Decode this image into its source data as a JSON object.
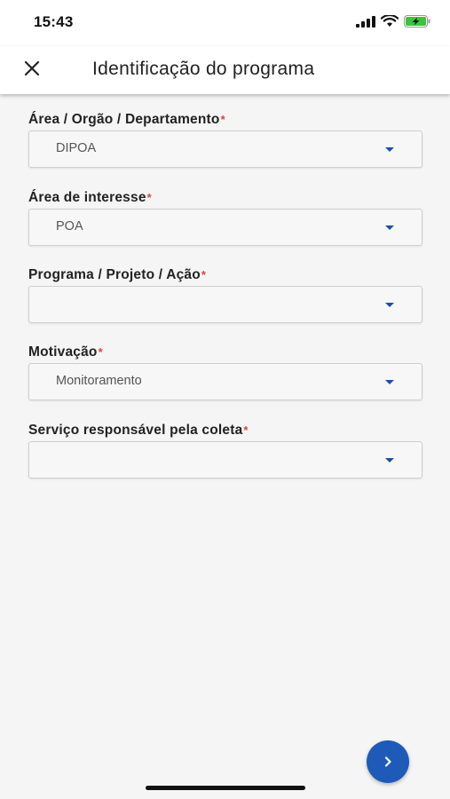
{
  "status_bar": {
    "time": "15:43",
    "icons": [
      "signal-icon",
      "wifi-icon",
      "battery-charging-icon"
    ],
    "battery_color": "#3ec33e"
  },
  "header": {
    "title": "Identificação do programa",
    "close_icon": "close-icon"
  },
  "form": {
    "required_marker": "*",
    "fields": [
      {
        "label": "Área / Orgão / Departamento",
        "value": "DIPOA"
      },
      {
        "label": "Área de interesse",
        "value": "POA"
      },
      {
        "label": "Programa / Projeto / Ação",
        "value": ""
      },
      {
        "label": "Motivação",
        "value": "Monitoramento"
      },
      {
        "label": "Serviço responsável pela coleta",
        "value": ""
      }
    ]
  },
  "actions": {
    "next_icon": "chevron-right-icon"
  },
  "colors": {
    "accent": "#1e5bb8",
    "required": "#d9453b",
    "caret": "#1e4fa3"
  }
}
